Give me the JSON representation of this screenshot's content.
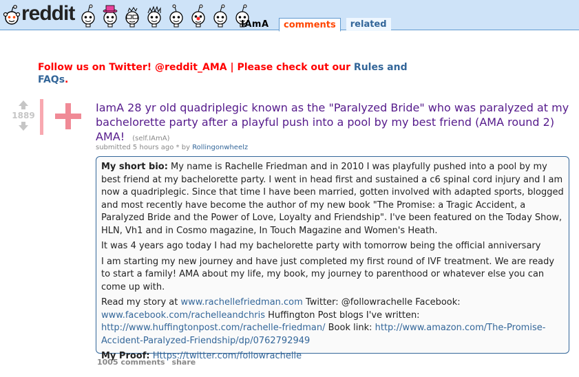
{
  "header": {
    "logo_text": "reddit",
    "subreddit": "IAmA",
    "tabs": [
      {
        "label": "comments",
        "selected": true
      },
      {
        "label": "related",
        "selected": false
      }
    ]
  },
  "announcement": {
    "text": "Follow us on Twitter! @reddit_AMA | Please check out our",
    "rules_link": "Rules",
    "and_text": "and",
    "faqs_link": "FAQs",
    "period": "."
  },
  "post": {
    "score": "1889",
    "title": "IamA 28 yr old quadriplegic known as the \"Paralyzed Bride\" who was paralyzed at my bachelorette party after a playful push into a pool by my best friend (AMA round 2) AMA!",
    "domain": "(self.IAmA)",
    "tagline_prefix": "submitted 5 hours ago * by",
    "author": "Rollingonwheelz",
    "bio_label": "My short bio:",
    "bio_text": "My name is Rachelle Friedman and in 2010 I was playfully pushed into a pool by my best friend at my bachelorette party. I went in head first and sustained a c6 spinal cord injury and I am now a quadriplegic. Since that time I have been married, gotten involved with adapted sports, blogged and most recently have become the author of my new book \"The Promise: a Tragic Accident, a Paralyzed Bride and the Power of Love, Loyalty and Friendship\". I've been featured on the Today Show, HLN, Vh1 and in Cosmo magazine, In Touch Magazine and Women's Heath.",
    "paragraph2": "It was 4 years ago today I had my bachelorette party with tomorrow being the official anniversary",
    "paragraph3": "I am starting my new journey and have just completed my first round of IVF treatment. We are ready to start a family! AMA about my life, my book, my journey to parenthood or whatever else you can come up with.",
    "read_prefix": "Read my story at",
    "site_link": "www.rachellefriedman.com",
    "twitter_text": "Twitter: @followrachelle Facebook:",
    "facebook_link": "www.facebook.com/rachelleandchris",
    "huffpo_text": "Huffington Post blogs I've written:",
    "huffpo_link": "http://www.huffingtonpost.com/rachelle-friedman/",
    "book_text": "Book link:",
    "book_link": "http://www.amazon.com/The-Promise-Accident-Paralyzed-Friendship/dp/0762792949",
    "proof_label": "My Proof:",
    "proof_link": "Https://twitter.com/followrachelle",
    "comments": "1005 comments",
    "share": "share"
  },
  "icons": [
    "reddit-alien-icon",
    "upvote-arrow-icon",
    "downvote-arrow-icon",
    "plus-thumbnail-icon"
  ],
  "colors": {
    "header_bg": "#cee3f8",
    "link": "#336699",
    "visited_title": "#551a8b",
    "announcement": "#ff0000",
    "selected_tab": "#ff4500"
  }
}
